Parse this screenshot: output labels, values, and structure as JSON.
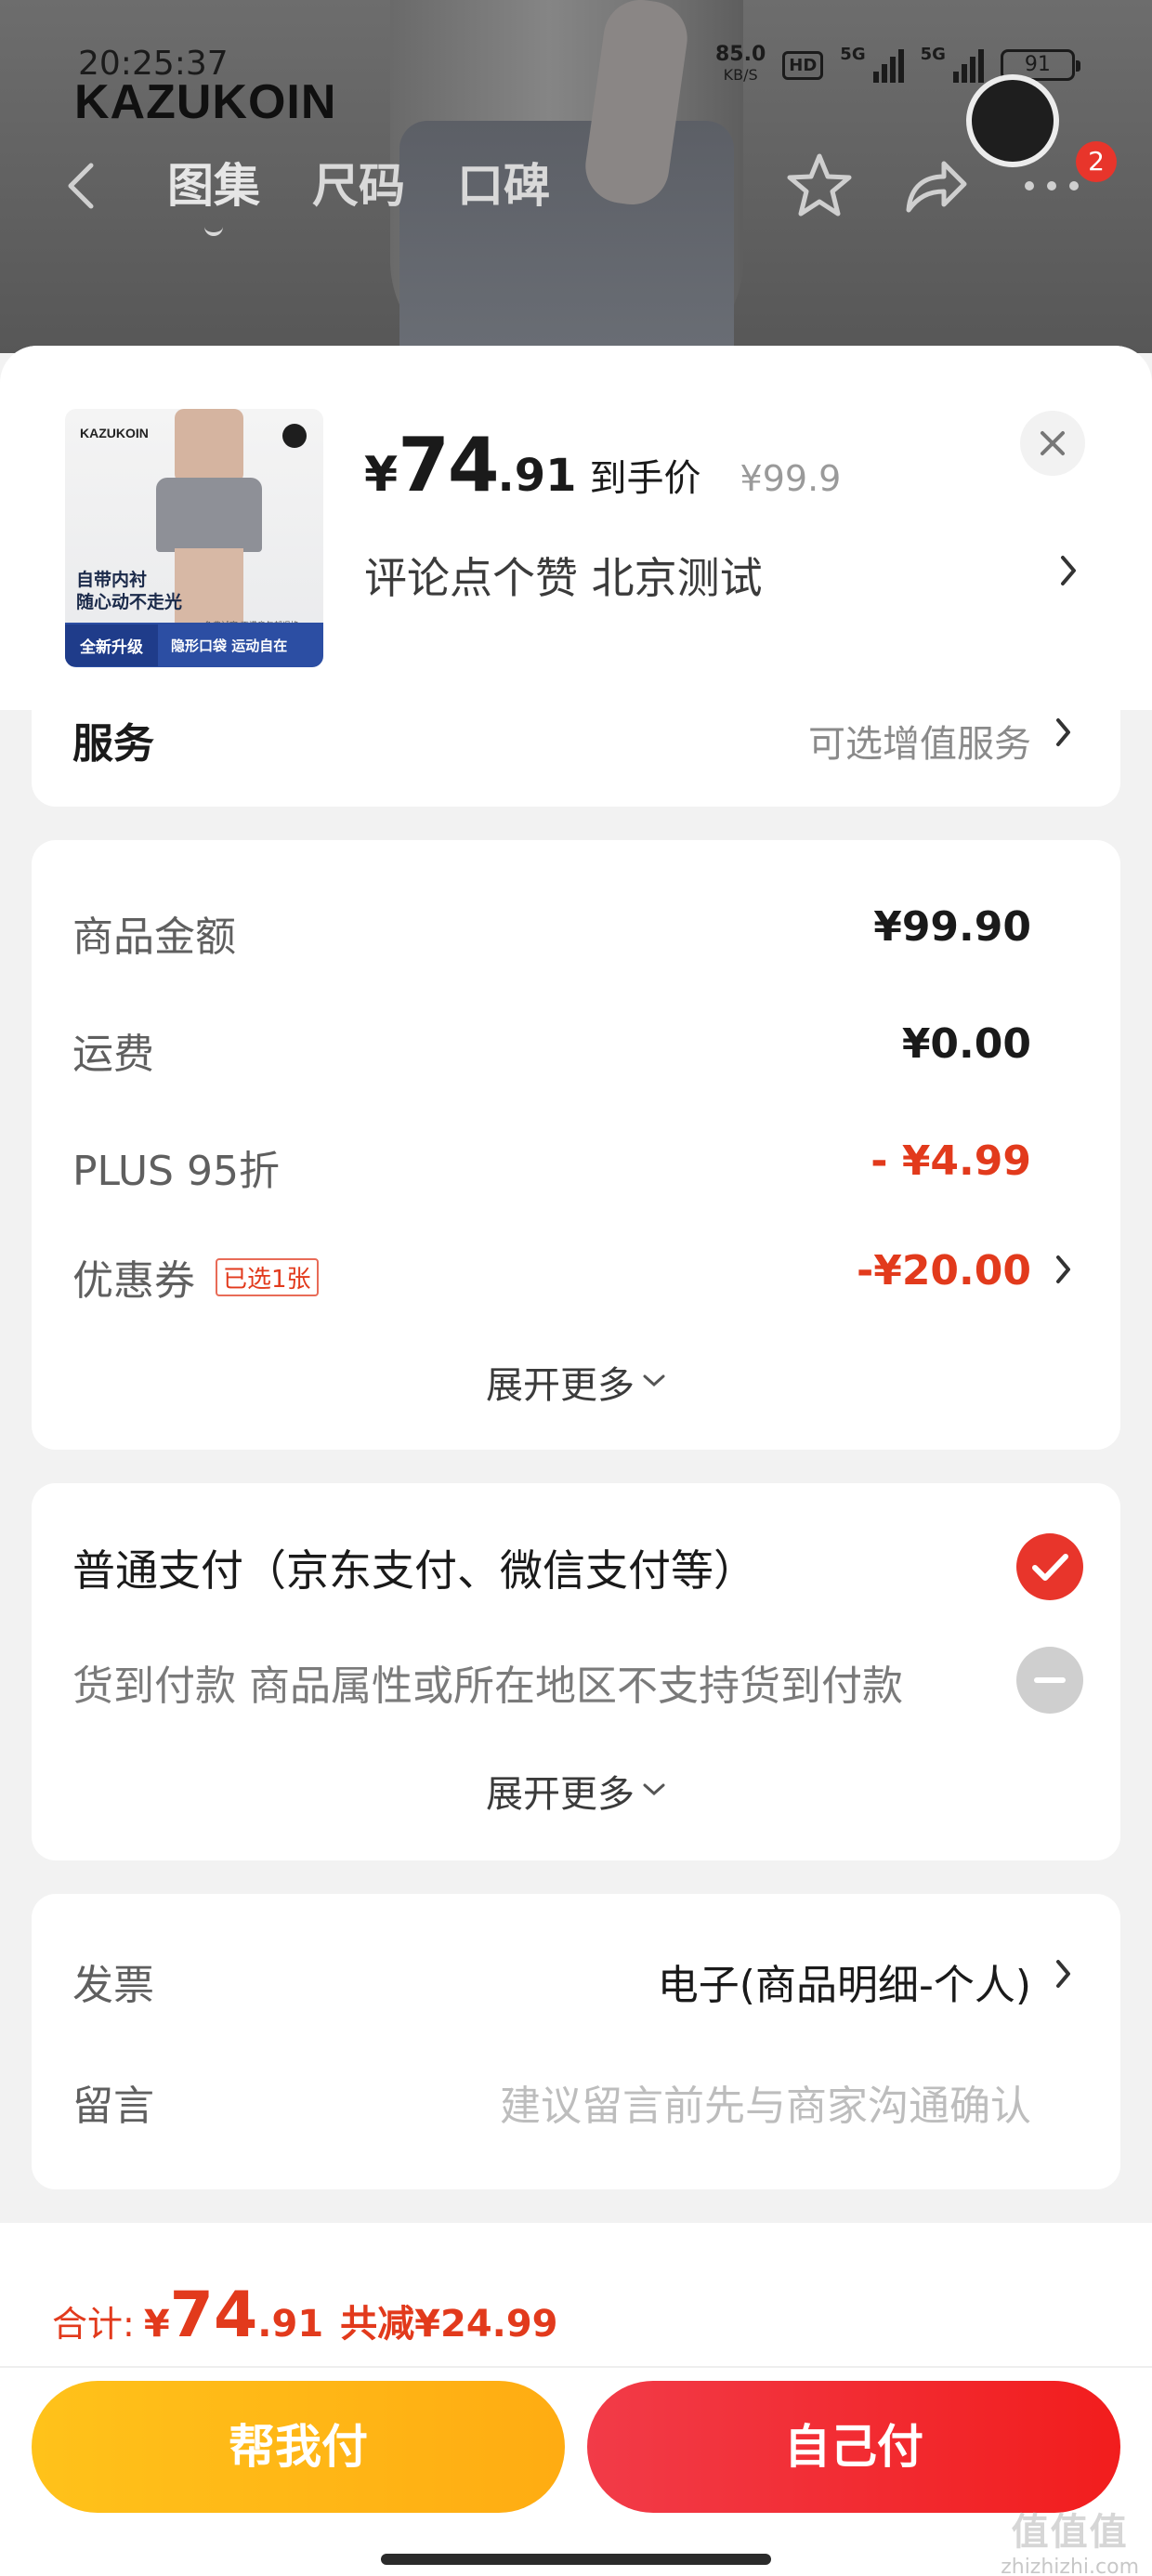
{
  "status_bar": {
    "time": "20:25:37",
    "net_speed": "85.0",
    "net_unit": "KB/S",
    "hd": "HD",
    "network1": "5G",
    "network2": "5G",
    "battery": "91"
  },
  "header": {
    "brand_logo_text": "KAZUKOIN",
    "tabs": [
      "图集",
      "尺码",
      "口碑"
    ],
    "cart_badge": "2"
  },
  "product": {
    "thumb": {
      "brand": "KAZUKOIN",
      "tagline1": "自带内衬",
      "tagline2": "随心动不走光",
      "small_text": "免费试穿 不满意包邮退换",
      "bar_left": "全新升级",
      "bar_right": "隐形口袋 运动自在"
    },
    "price_currency": "¥",
    "price_int": "74",
    "price_dec": ".91",
    "price_label": "到手价",
    "original_price": "¥99.9",
    "sku_text": "评论点个赞  北京测试"
  },
  "service": {
    "label": "服务",
    "value": "可选增值服务"
  },
  "amounts": {
    "rows": [
      {
        "label": "商品金额",
        "value": "¥99.90"
      },
      {
        "label": "运费",
        "value": "¥0.00"
      },
      {
        "label": "PLUS 95折",
        "value": "- ¥4.99"
      },
      {
        "label": "优惠券",
        "tag": "已选1张",
        "value": "-¥20.00"
      }
    ],
    "expand": "展开更多"
  },
  "payment": {
    "option1": "普通支付（京东支付、微信支付等）",
    "option2": "货到付款 商品属性或所在地区不支持货到付款",
    "expand": "展开更多"
  },
  "extra": {
    "invoice_label": "发票",
    "invoice_value": "电子(商品明细-个人)",
    "note_label": "留言",
    "note_placeholder": "建议留言前先与商家沟通确认"
  },
  "footer": {
    "total_label": "合计:",
    "total_currency": "¥",
    "total_int": "74",
    "total_dec": ".91",
    "reduce": "共减¥24.99",
    "btn_help": "帮我付",
    "btn_self": "自己付"
  },
  "watermark": {
    "line1": "值值值",
    "line2": "zhizhizhi.com"
  },
  "colors": {
    "accent_red": "#e23a1c",
    "button_yellow": "#ffb815",
    "button_red": "#f2282f"
  }
}
